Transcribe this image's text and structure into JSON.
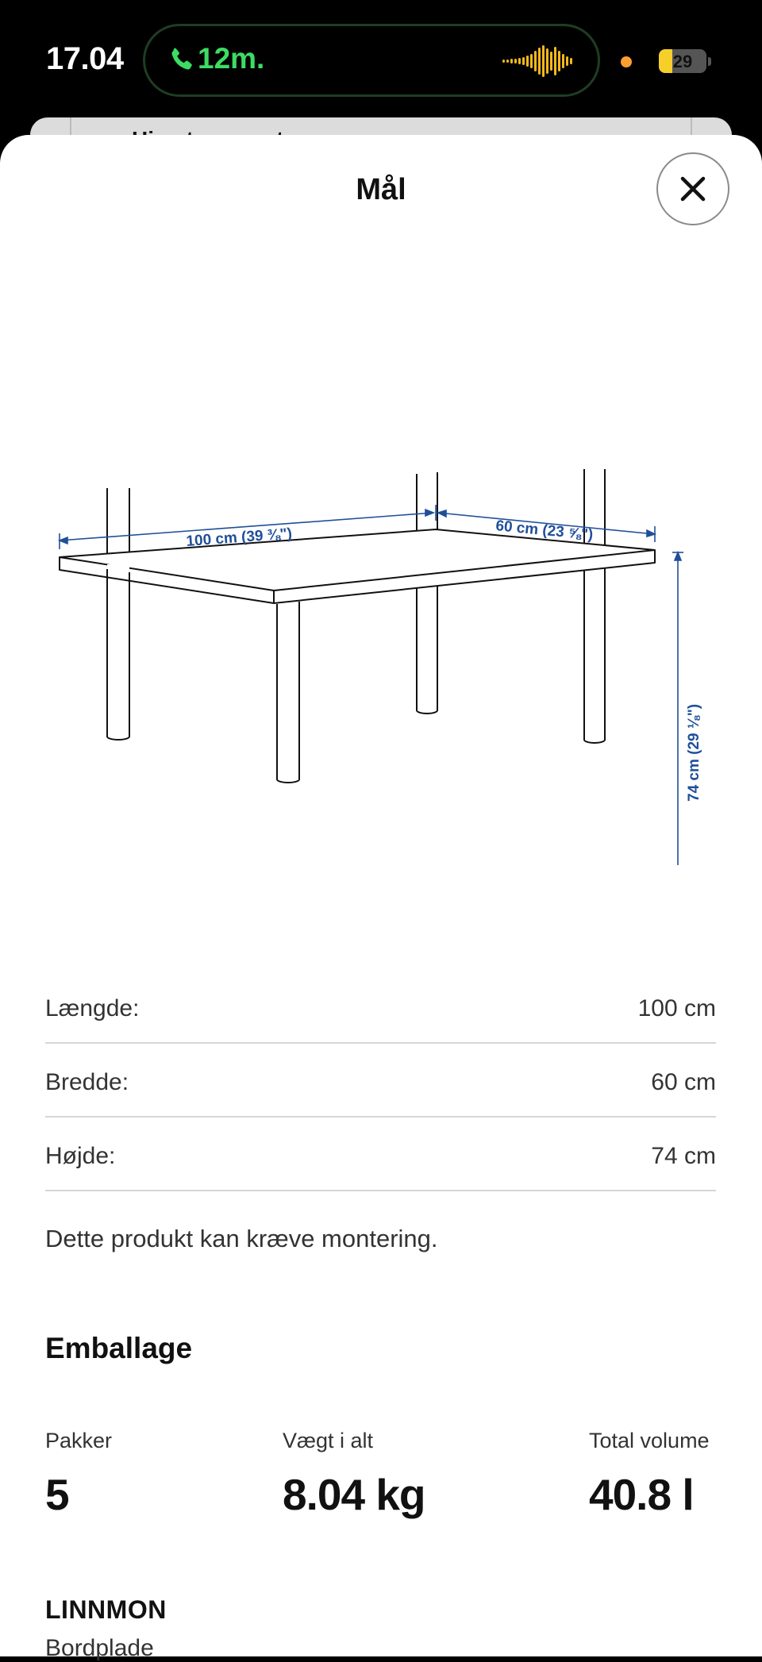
{
  "status_bar": {
    "time": "17.04",
    "call_duration": "12m.",
    "battery_level": "29",
    "battery_fraction": 0.29,
    "accent_call_color": "#3ddc63",
    "waveform_color": "#f6b91b"
  },
  "underlay": {
    "peek_text": "Hjemtransport"
  },
  "sheet": {
    "title": "Mål",
    "close_icon": "close-icon"
  },
  "diagram": {
    "length_label": "100 cm (39 ⅜\")",
    "width_label": "60 cm (23 ⅝\")",
    "height_label": "74 cm (29 ⅛\")",
    "annotation_color": "#1f4f9a"
  },
  "dimensions": [
    {
      "label": "Længde:",
      "value": "100 cm"
    },
    {
      "label": "Bredde:",
      "value": "60 cm"
    },
    {
      "label": "Højde:",
      "value": "74 cm"
    }
  ],
  "assembly_note": "Dette produkt kan kræve montering.",
  "packaging": {
    "heading": "Emballage",
    "packages_label": "Pakker",
    "packages_value": "5",
    "weight_label": "Vægt i alt",
    "weight_value": "8.04 kg",
    "volume_label": "Total volume",
    "volume_value": "40.8 l"
  },
  "item": {
    "name": "LINNMON",
    "type": "Bordplade"
  }
}
